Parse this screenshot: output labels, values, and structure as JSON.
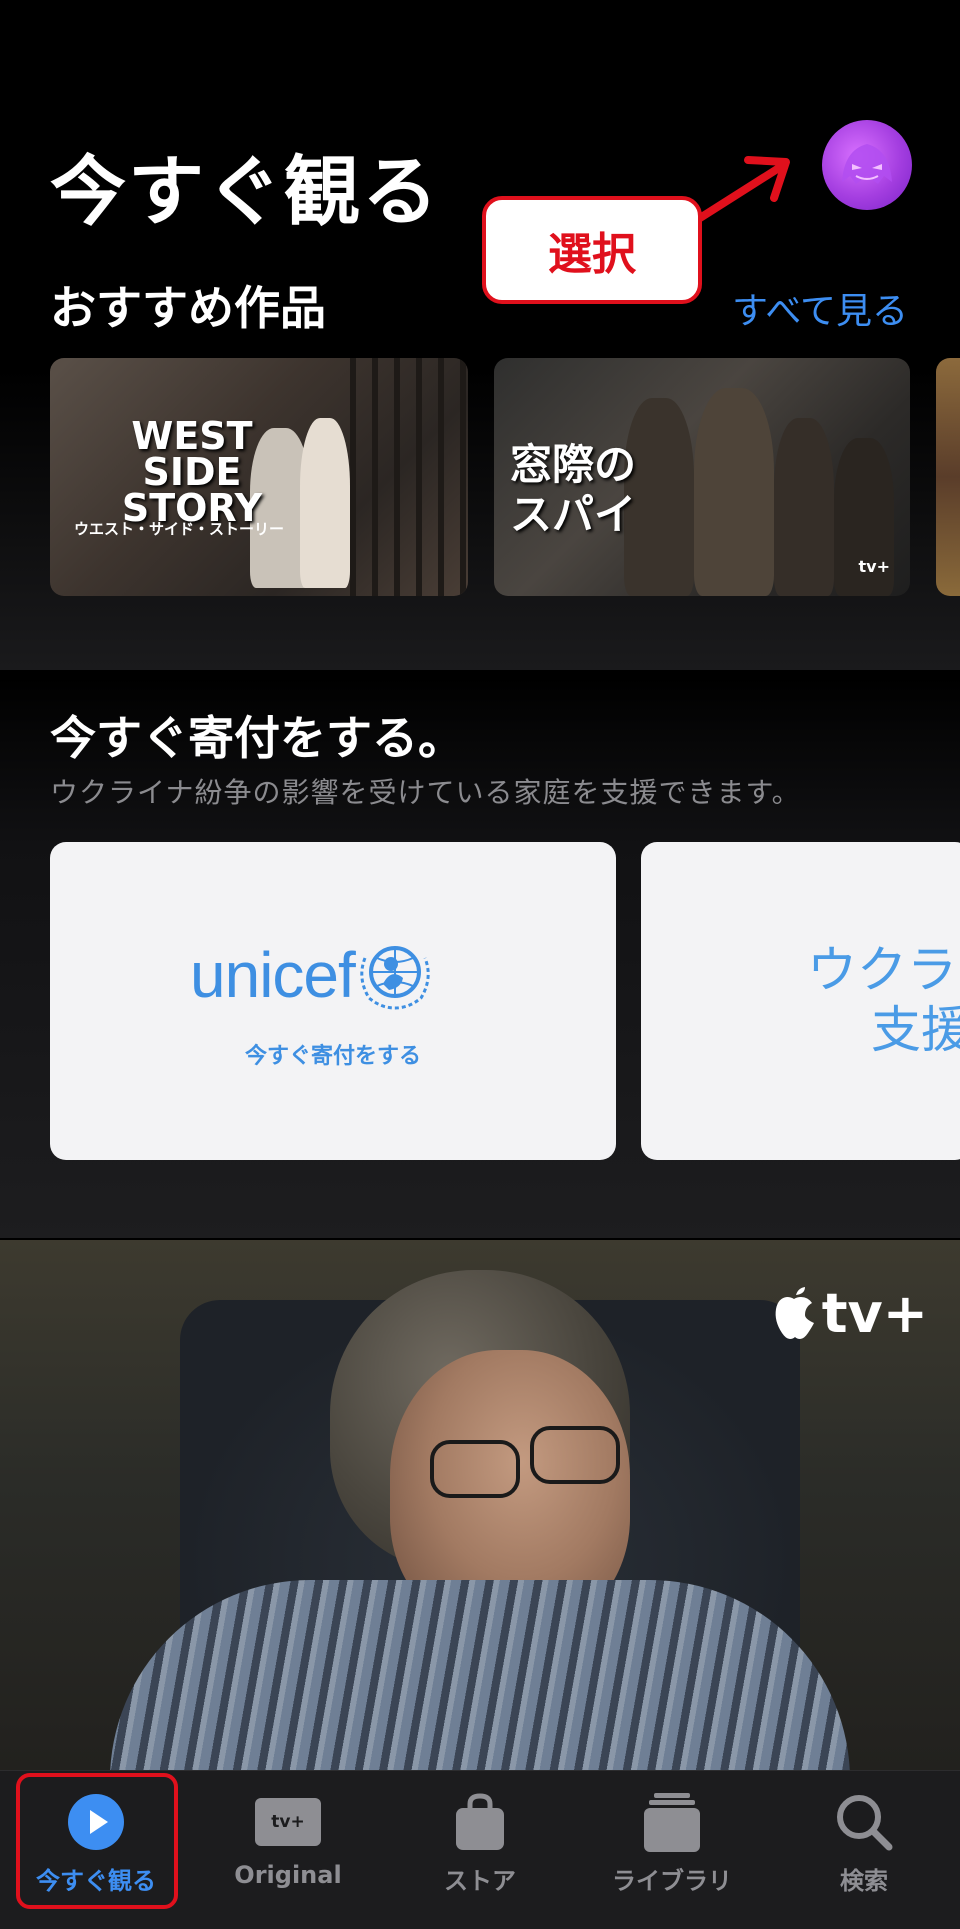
{
  "header": {
    "title": "今すぐ観る",
    "callout": "選択"
  },
  "recommended": {
    "section_title": "おすすめ作品",
    "see_all": "すべて見る",
    "cards": [
      {
        "title": "WEST SIDE STORY",
        "subtitle": "ウエスト・サイド・ストーリー"
      },
      {
        "title": "窓際のスパイ",
        "badge": "tv+"
      }
    ]
  },
  "donate": {
    "title": "今すぐ寄付をする。",
    "subtitle": "ウクライナ紛争の影響を受けている家庭を支援できます。",
    "cards": [
      {
        "logo_text": "unicef",
        "cta": "今すぐ寄付をする"
      },
      {
        "line1": "ウクライ",
        "line2": "支援"
      }
    ]
  },
  "hero": {
    "brand": "tv+"
  },
  "tabbar": {
    "tabs": [
      {
        "label": "今すぐ観る",
        "icon": "play-circle-icon",
        "active": true
      },
      {
        "label": "Original",
        "icon": "appletv-plus-icon",
        "badge": "tv+"
      },
      {
        "label": "ストア",
        "icon": "shopping-bag-icon"
      },
      {
        "label": "ライブラリ",
        "icon": "library-stack-icon"
      },
      {
        "label": "検索",
        "icon": "search-icon"
      }
    ]
  },
  "colors": {
    "accent": "#3d8ef2",
    "callout_red": "#e0101c",
    "unicef_blue": "#3e8fe2"
  }
}
